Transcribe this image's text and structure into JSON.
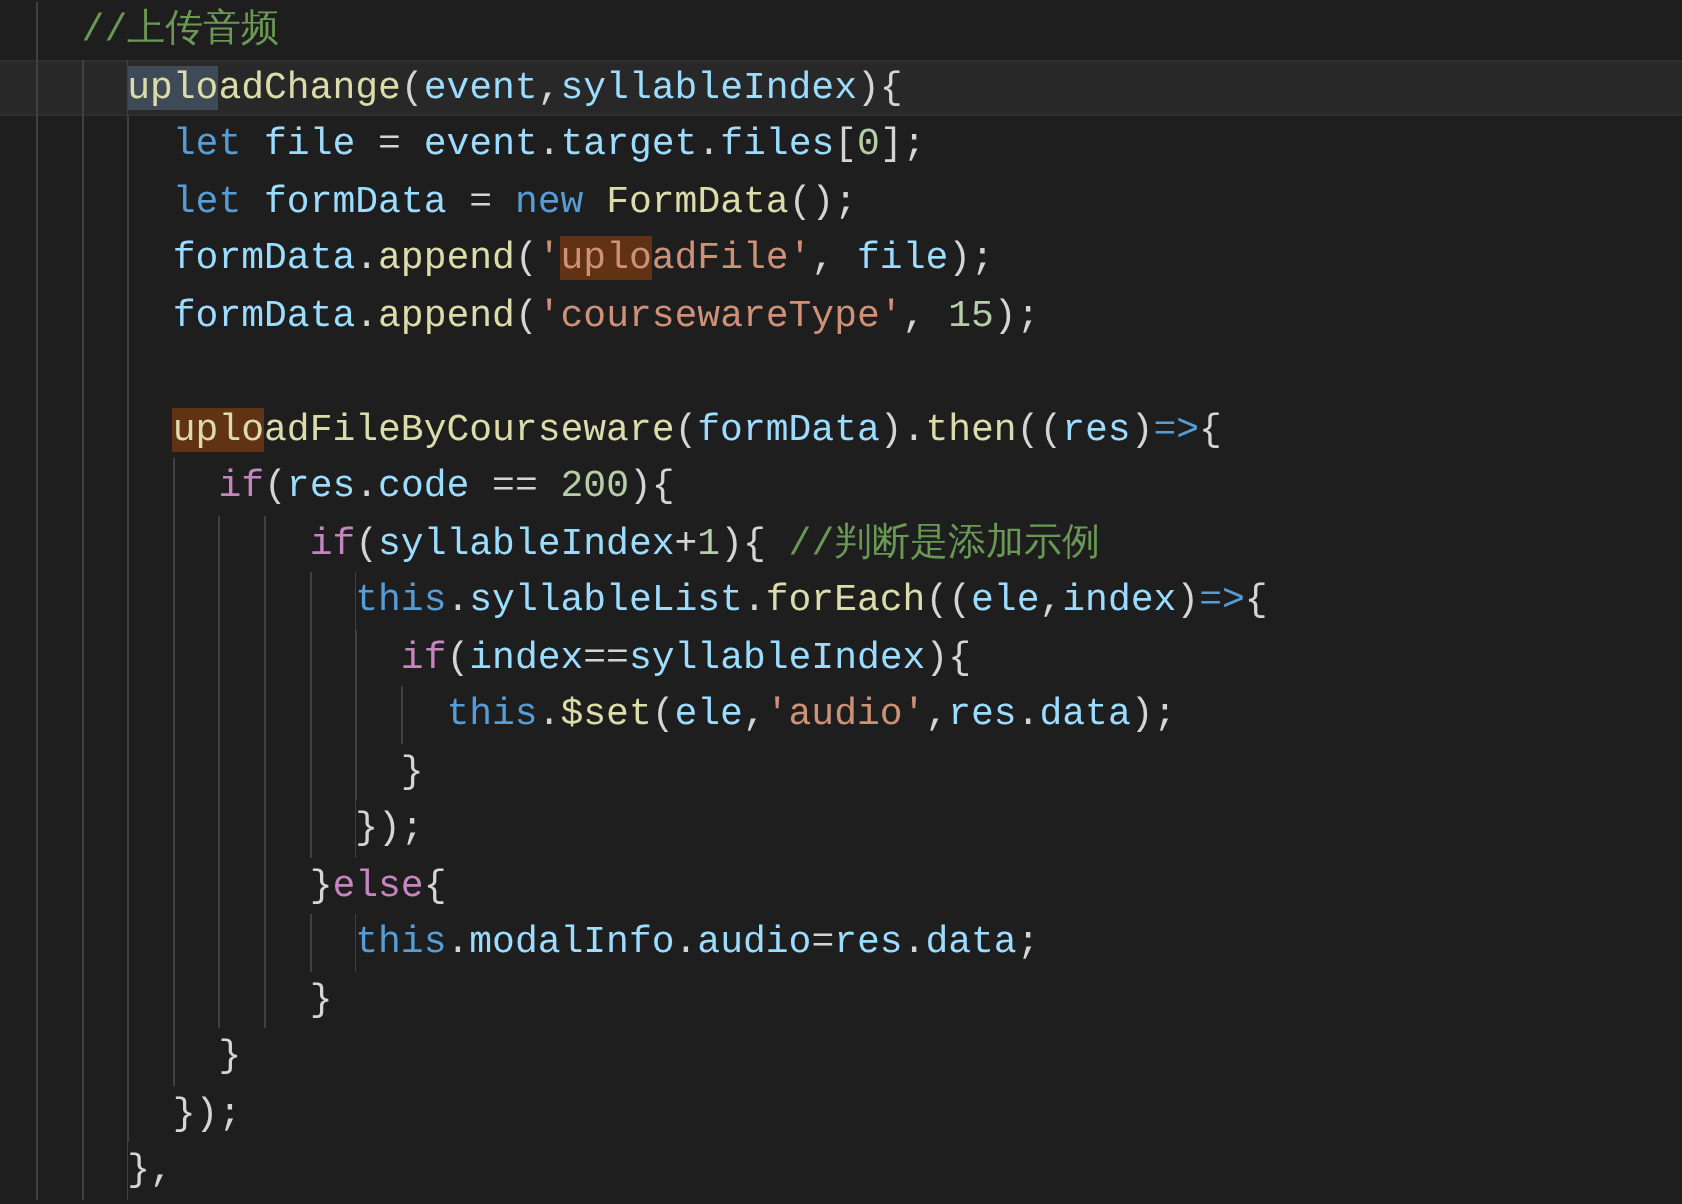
{
  "editor": {
    "lines": [
      {
        "kind": "code",
        "tokens": [
          {
            "text": "//上传音频",
            "kind": "comment"
          }
        ]
      },
      {
        "kind": "group",
        "children": [
          {
            "kind": "code",
            "current": true,
            "tokens": [
              {
                "text": "uplo",
                "kind": "function",
                "selected": true
              },
              {
                "text": "adChange",
                "kind": "function"
              },
              {
                "text": "(",
                "kind": "punct"
              },
              {
                "text": "event",
                "kind": "variable"
              },
              {
                "text": ",",
                "kind": "punct"
              },
              {
                "text": "syllableIndex",
                "kind": "variable"
              },
              {
                "text": "){",
                "kind": "punct"
              }
            ],
            "children": [
              {
                "kind": "code",
                "tokens": [
                  {
                    "text": "let",
                    "kind": "keyword"
                  },
                  {
                    "text": " file",
                    "kind": "variable"
                  },
                  {
                    "text": " = ",
                    "kind": "punct"
                  },
                  {
                    "text": "event",
                    "kind": "variable"
                  },
                  {
                    "text": ".",
                    "kind": "punct"
                  },
                  {
                    "text": "target",
                    "kind": "variable"
                  },
                  {
                    "text": ".",
                    "kind": "punct"
                  },
                  {
                    "text": "files",
                    "kind": "variable"
                  },
                  {
                    "text": "[",
                    "kind": "punct"
                  },
                  {
                    "text": "0",
                    "kind": "number"
                  },
                  {
                    "text": "];",
                    "kind": "punct"
                  }
                ]
              },
              {
                "kind": "code",
                "tokens": [
                  {
                    "text": "let",
                    "kind": "keyword"
                  },
                  {
                    "text": " formData",
                    "kind": "variable"
                  },
                  {
                    "text": " = ",
                    "kind": "punct"
                  },
                  {
                    "text": "new",
                    "kind": "keyword"
                  },
                  {
                    "text": " FormData",
                    "kind": "function"
                  },
                  {
                    "text": "();",
                    "kind": "punct"
                  }
                ]
              },
              {
                "kind": "code",
                "tokens": [
                  {
                    "text": "formData",
                    "kind": "variable"
                  },
                  {
                    "text": ".",
                    "kind": "punct"
                  },
                  {
                    "text": "append",
                    "kind": "function"
                  },
                  {
                    "text": "(",
                    "kind": "punct"
                  },
                  {
                    "text": "'",
                    "kind": "string"
                  },
                  {
                    "text": "uplo",
                    "kind": "string",
                    "matched": true
                  },
                  {
                    "text": "adFile'",
                    "kind": "string"
                  },
                  {
                    "text": ", ",
                    "kind": "punct"
                  },
                  {
                    "text": "file",
                    "kind": "variable"
                  },
                  {
                    "text": ");",
                    "kind": "punct"
                  }
                ]
              },
              {
                "kind": "code",
                "tokens": [
                  {
                    "text": "formData",
                    "kind": "variable"
                  },
                  {
                    "text": ".",
                    "kind": "punct"
                  },
                  {
                    "text": "append",
                    "kind": "function"
                  },
                  {
                    "text": "(",
                    "kind": "punct"
                  },
                  {
                    "text": "'coursewareType'",
                    "kind": "string"
                  },
                  {
                    "text": ", ",
                    "kind": "punct"
                  },
                  {
                    "text": "15",
                    "kind": "number"
                  },
                  {
                    "text": ");",
                    "kind": "punct"
                  }
                ]
              },
              {
                "kind": "blank"
              },
              {
                "kind": "code",
                "tokens": [
                  {
                    "text": "uplo",
                    "kind": "function",
                    "matched": true
                  },
                  {
                    "text": "adFileByCourseware",
                    "kind": "function"
                  },
                  {
                    "text": "(",
                    "kind": "punct"
                  },
                  {
                    "text": "formData",
                    "kind": "variable"
                  },
                  {
                    "text": ").",
                    "kind": "punct"
                  },
                  {
                    "text": "then",
                    "kind": "function"
                  },
                  {
                    "text": "((",
                    "kind": "punct"
                  },
                  {
                    "text": "res",
                    "kind": "variable"
                  },
                  {
                    "text": ")",
                    "kind": "punct"
                  },
                  {
                    "text": "=>",
                    "kind": "keyword"
                  },
                  {
                    "text": "{",
                    "kind": "punct"
                  }
                ],
                "children": [
                  {
                    "kind": "code",
                    "tokens": [
                      {
                        "text": "if",
                        "kind": "control"
                      },
                      {
                        "text": "(",
                        "kind": "punct"
                      },
                      {
                        "text": "res",
                        "kind": "variable"
                      },
                      {
                        "text": ".",
                        "kind": "punct"
                      },
                      {
                        "text": "code",
                        "kind": "variable"
                      },
                      {
                        "text": " == ",
                        "kind": "punct"
                      },
                      {
                        "text": "200",
                        "kind": "number"
                      },
                      {
                        "text": "){",
                        "kind": "punct"
                      }
                    ],
                    "children": [
                      {
                        "kind": "group",
                        "children": [
                          {
                            "kind": "code",
                            "tokens": [
                              {
                                "text": "if",
                                "kind": "control"
                              },
                              {
                                "text": "(",
                                "kind": "punct"
                              },
                              {
                                "text": "syllableIndex",
                                "kind": "variable"
                              },
                              {
                                "text": "+",
                                "kind": "punct"
                              },
                              {
                                "text": "1",
                                "kind": "number"
                              },
                              {
                                "text": "){ ",
                                "kind": "punct"
                              },
                              {
                                "text": "//判断是添加示例",
                                "kind": "comment"
                              }
                            ],
                            "children": [
                              {
                                "kind": "code",
                                "tokens": [
                                  {
                                    "text": "this",
                                    "kind": "keyword"
                                  },
                                  {
                                    "text": ".",
                                    "kind": "punct"
                                  },
                                  {
                                    "text": "syllableList",
                                    "kind": "variable"
                                  },
                                  {
                                    "text": ".",
                                    "kind": "punct"
                                  },
                                  {
                                    "text": "forEach",
                                    "kind": "function"
                                  },
                                  {
                                    "text": "((",
                                    "kind": "punct"
                                  },
                                  {
                                    "text": "ele",
                                    "kind": "variable"
                                  },
                                  {
                                    "text": ",",
                                    "kind": "punct"
                                  },
                                  {
                                    "text": "index",
                                    "kind": "variable"
                                  },
                                  {
                                    "text": ")",
                                    "kind": "punct"
                                  },
                                  {
                                    "text": "=>",
                                    "kind": "keyword"
                                  },
                                  {
                                    "text": "{",
                                    "kind": "punct"
                                  }
                                ],
                                "children": [
                                  {
                                    "kind": "code",
                                    "tokens": [
                                      {
                                        "text": "if",
                                        "kind": "control"
                                      },
                                      {
                                        "text": "(",
                                        "kind": "punct"
                                      },
                                      {
                                        "text": "index",
                                        "kind": "variable"
                                      },
                                      {
                                        "text": "==",
                                        "kind": "punct"
                                      },
                                      {
                                        "text": "syllableIndex",
                                        "kind": "variable"
                                      },
                                      {
                                        "text": "){",
                                        "kind": "punct"
                                      }
                                    ],
                                    "children": [
                                      {
                                        "kind": "code",
                                        "tokens": [
                                          {
                                            "text": "this",
                                            "kind": "keyword"
                                          },
                                          {
                                            "text": ".",
                                            "kind": "punct"
                                          },
                                          {
                                            "text": "$set",
                                            "kind": "function"
                                          },
                                          {
                                            "text": "(",
                                            "kind": "punct"
                                          },
                                          {
                                            "text": "ele",
                                            "kind": "variable"
                                          },
                                          {
                                            "text": ",",
                                            "kind": "punct"
                                          },
                                          {
                                            "text": "'audio'",
                                            "kind": "string"
                                          },
                                          {
                                            "text": ",",
                                            "kind": "punct"
                                          },
                                          {
                                            "text": "res",
                                            "kind": "variable"
                                          },
                                          {
                                            "text": ".",
                                            "kind": "punct"
                                          },
                                          {
                                            "text": "data",
                                            "kind": "variable"
                                          },
                                          {
                                            "text": ");",
                                            "kind": "punct"
                                          }
                                        ]
                                      }
                                    ]
                                  },
                                  {
                                    "kind": "code",
                                    "tokens": [
                                      {
                                        "text": "}",
                                        "kind": "punct"
                                      }
                                    ]
                                  }
                                ]
                              },
                              {
                                "kind": "code",
                                "tokens": [
                                  {
                                    "text": "});",
                                    "kind": "punct"
                                  }
                                ]
                              }
                            ]
                          },
                          {
                            "kind": "code",
                            "tokens": [
                              {
                                "text": "}",
                                "kind": "punct"
                              },
                              {
                                "text": "else",
                                "kind": "control"
                              },
                              {
                                "text": "{",
                                "kind": "punct"
                              }
                            ],
                            "children": [
                              {
                                "kind": "code",
                                "tokens": [
                                  {
                                    "text": "this",
                                    "kind": "keyword"
                                  },
                                  {
                                    "text": ".",
                                    "kind": "punct"
                                  },
                                  {
                                    "text": "modalInfo",
                                    "kind": "variable"
                                  },
                                  {
                                    "text": ".",
                                    "kind": "punct"
                                  },
                                  {
                                    "text": "audio",
                                    "kind": "variable"
                                  },
                                  {
                                    "text": "=",
                                    "kind": "punct"
                                  },
                                  {
                                    "text": "res",
                                    "kind": "variable"
                                  },
                                  {
                                    "text": ".",
                                    "kind": "punct"
                                  },
                                  {
                                    "text": "data",
                                    "kind": "variable"
                                  },
                                  {
                                    "text": ";",
                                    "kind": "punct"
                                  }
                                ]
                              }
                            ]
                          },
                          {
                            "kind": "code",
                            "tokens": [
                              {
                                "text": "}",
                                "kind": "punct"
                              }
                            ]
                          }
                        ]
                      }
                    ]
                  },
                  {
                    "kind": "code",
                    "tokens": [
                      {
                        "text": "}",
                        "kind": "punct"
                      }
                    ]
                  }
                ]
              },
              {
                "kind": "code",
                "tokens": [
                  {
                    "text": "});",
                    "kind": "punct"
                  }
                ]
              }
            ]
          },
          {
            "kind": "code",
            "tokens": [
              {
                "text": "},",
                "kind": "punct"
              }
            ]
          }
        ]
      }
    ]
  }
}
